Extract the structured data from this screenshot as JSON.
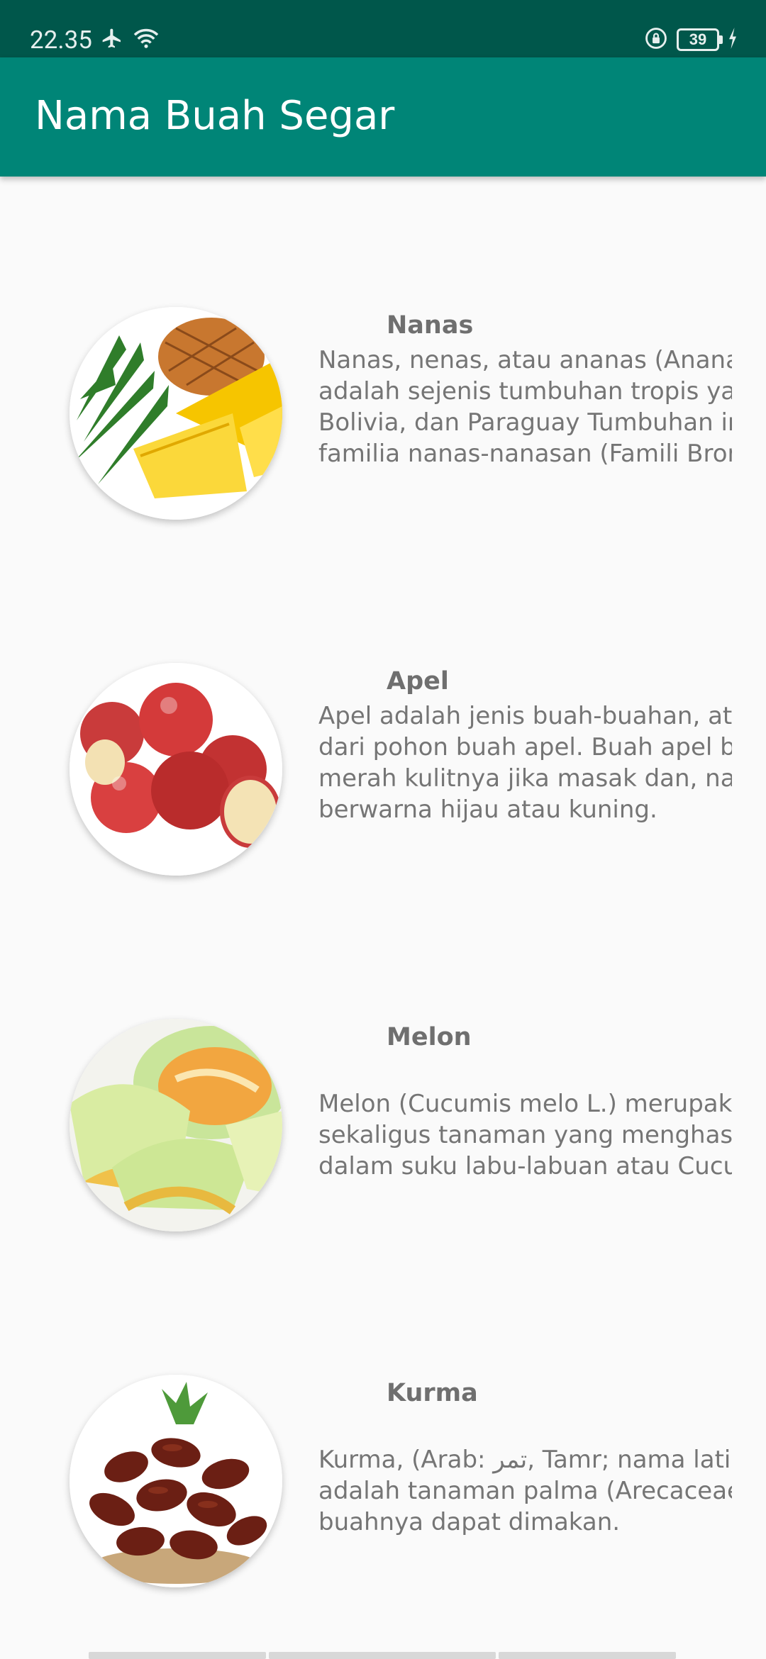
{
  "status_bar": {
    "time": "22.35",
    "battery": "39",
    "icons": [
      "airplane-icon",
      "wifi-icon",
      "rotation-lock-icon",
      "battery-icon",
      "charging-icon"
    ]
  },
  "app_bar": {
    "title": "Nama Buah Segar"
  },
  "colors": {
    "status_bar": "#00574b",
    "app_bar": "#008577",
    "background": "#fafafa",
    "text": "#757575"
  },
  "fruits": [
    {
      "name": "Nanas",
      "image": "pineapple-image",
      "lines": [
        "Nanas, nenas, atau ananas (Anana",
        "adalah sejenis tumbuhan tropis yar",
        "Bolivia, dan Paraguay Tumbuhan in",
        "familia nanas-nanasan (Famili Bror"
      ]
    },
    {
      "name": "Apel",
      "image": "apple-image",
      "lines": [
        "Apel adalah jenis buah-buahan, ata",
        "dari pohon buah apel. Buah apel bia",
        "merah kulitnya jika masak dan, nan",
        "berwarna hijau atau kuning."
      ]
    },
    {
      "name": "Melon",
      "image": "melon-image",
      "lines": [
        "Melon (Cucumis melo L.) merupaka",
        "sekaligus tanaman yang menghasi",
        "dalam suku labu-labuan atau Cucur"
      ]
    },
    {
      "name": "Kurma",
      "image": "dates-image",
      "lines": [
        "Kurma, (Arab: تمر, Tamr; nama latin",
        "adalah tanaman palma (Arecaceae",
        "buahnya dapat dimakan."
      ]
    }
  ]
}
